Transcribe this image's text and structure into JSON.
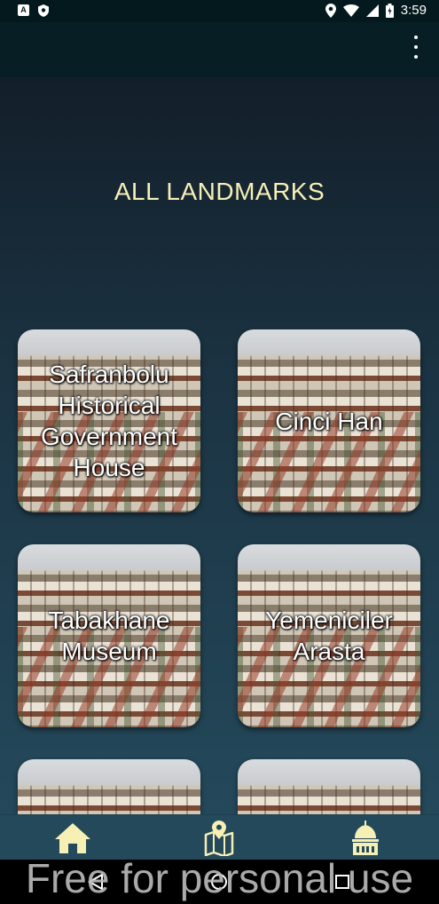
{
  "status_bar": {
    "time": "3:59",
    "left_icons": [
      "app-a-icon",
      "shield-icon"
    ],
    "right_icons": [
      "location-icon",
      "wifi-icon",
      "battery-icon"
    ]
  },
  "app_bar": {
    "menu_icon": "more-vert-icon"
  },
  "page": {
    "title": "ALL LANDMARKS"
  },
  "landmarks": [
    {
      "name": "Safranbolu Historical Government House"
    },
    {
      "name": "Cinci Han"
    },
    {
      "name": "Tabakhane Museum"
    },
    {
      "name": "Yemeniciler Arasta"
    },
    {
      "name": ""
    },
    {
      "name": ""
    }
  ],
  "bottom_nav": {
    "items": [
      {
        "icon": "home-icon"
      },
      {
        "icon": "map-icon"
      },
      {
        "icon": "mosque-icon"
      }
    ],
    "color": "#f6f0b5"
  },
  "watermark": "Free for personal use",
  "colors": {
    "accent_text": "#f6f0b5",
    "background_top": "#131e2a",
    "background_bottom": "#24495b"
  }
}
